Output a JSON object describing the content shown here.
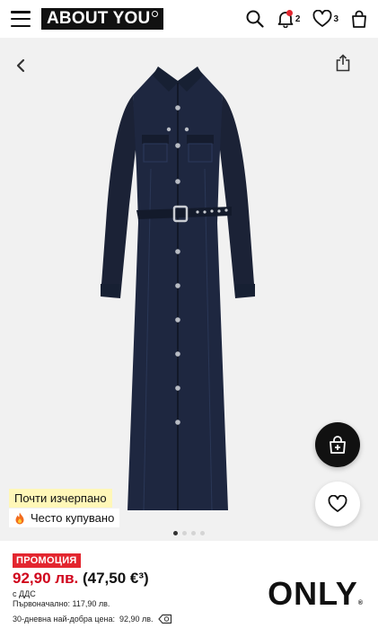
{
  "header": {
    "logo_text": "ABOUT YOU",
    "notifications_count": "2",
    "wishlist_count": "3",
    "icons": [
      "menu-icon",
      "search-icon",
      "bell-icon",
      "heart-icon",
      "bag-icon"
    ]
  },
  "gallery": {
    "badges": {
      "stock": "Почти изчерпано",
      "popular": "Често купувано"
    },
    "slide_count": 4,
    "active_slide": 1
  },
  "product": {
    "promo_label": "ПРОМОЦИЯ",
    "price_bgn": "92,90 лв.",
    "price_eur": "(47,50 €³)",
    "vat_note": "с ДДС",
    "original_price": "Първоначално: 117,90 лв.",
    "lowest_price_label": "30-дневна най-добра цена:",
    "lowest_price_value": "92,90 лв.",
    "brand": "ONLY",
    "brand_mark": "®"
  },
  "colors": {
    "accent_red": "#e3262f",
    "price_red": "#d0021b",
    "denim": "#1b2236",
    "tag_yellow": "#fff7b8"
  }
}
